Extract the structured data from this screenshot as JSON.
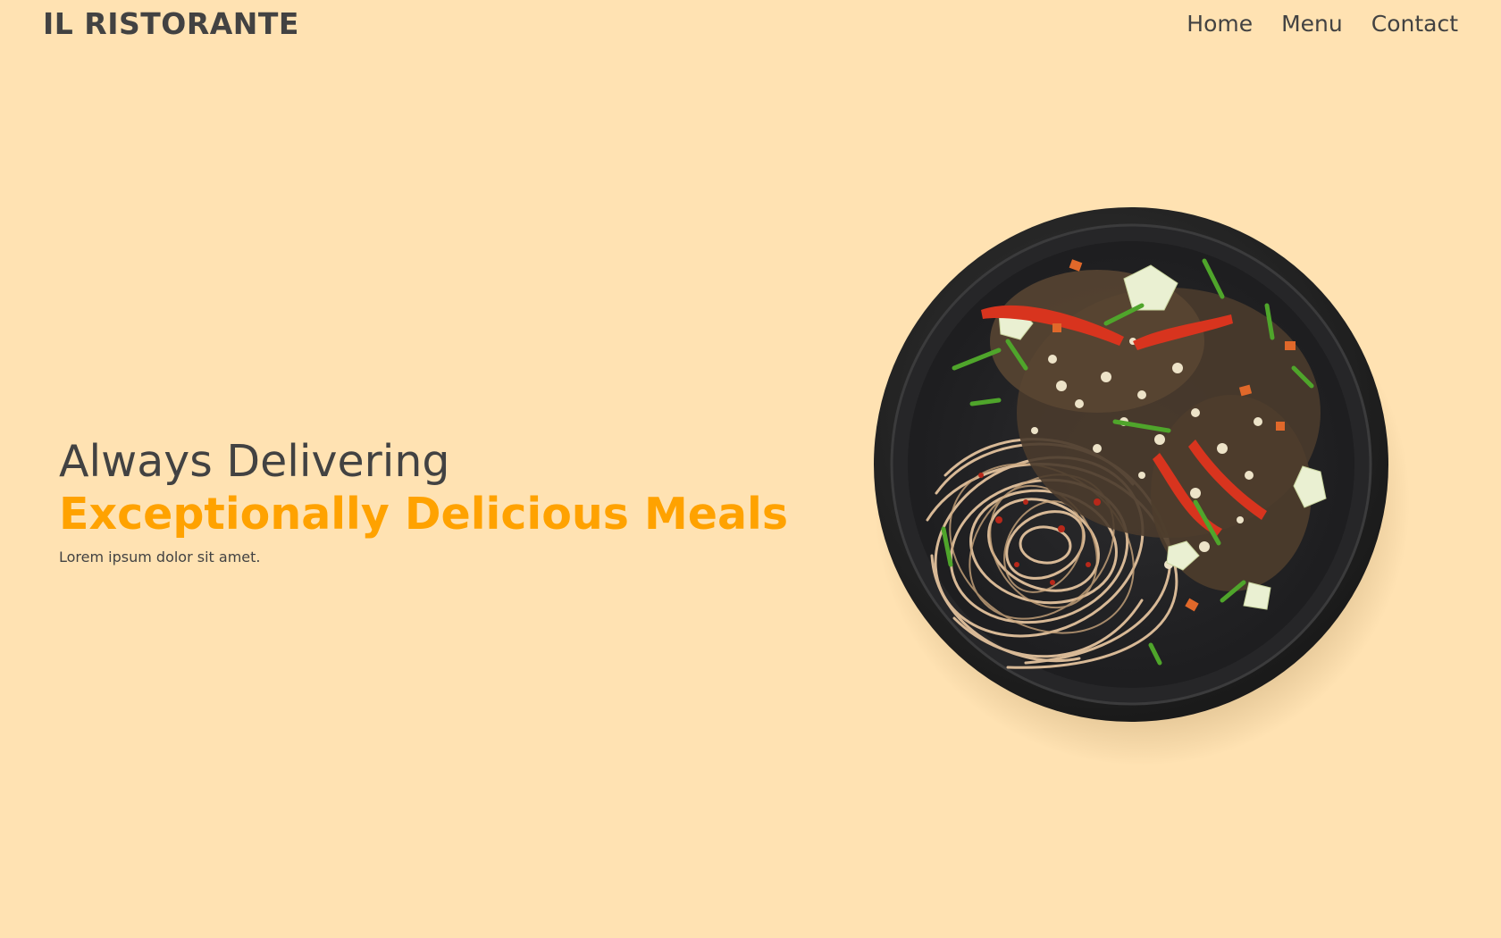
{
  "header": {
    "brand": "IL RISTORANTE",
    "nav": [
      {
        "label": "Home"
      },
      {
        "label": "Menu"
      },
      {
        "label": "Contact"
      }
    ]
  },
  "hero": {
    "line1": "Always Delivering",
    "line2": "Exceptionally Delicious Meals",
    "subtitle": "Lorem ipsum dolor sit amet."
  },
  "colors": {
    "background": "#ffe2b2",
    "text": "#424242",
    "accent": "#ffa200"
  }
}
